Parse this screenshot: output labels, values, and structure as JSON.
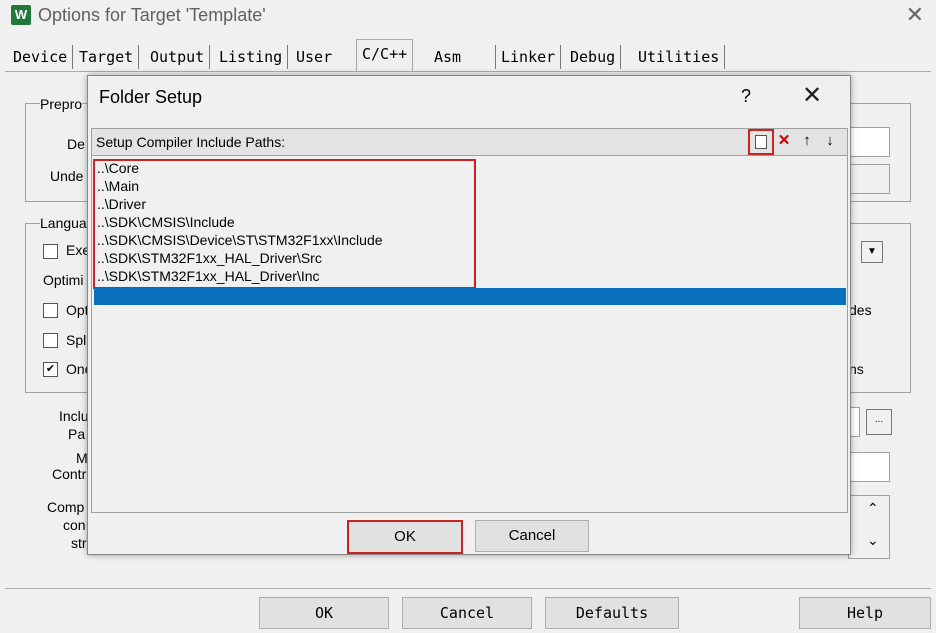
{
  "window": {
    "title": "Options for Target 'Template'",
    "logo_text": "W"
  },
  "tabs": [
    "Device",
    "Target",
    "Output",
    "Listing",
    "User",
    "C/C++",
    "Asm",
    "Linker",
    "Debug",
    "Utilities"
  ],
  "active_tab": "C/C++",
  "background_labels": {
    "prepro": "Prepro",
    "de": "De",
    "unde": "Unde",
    "langua": "Langua",
    "exe": "Exe",
    "optimi": "Optimi",
    "opt": "Opt",
    "spl": "Spl",
    "one": "One",
    "incl": "Inclu",
    "pa": "Pa",
    "m": "M",
    "contr": "Contr",
    "comp": "Comp",
    "con": "con",
    "str": "str",
    "des": "des",
    "ns": "ns",
    "browse": "..."
  },
  "bottom_buttons": {
    "ok": "OK",
    "cancel": "Cancel",
    "defaults": "Defaults",
    "help": "Help"
  },
  "dialog": {
    "title": "Folder Setup",
    "help": "?",
    "close": "✕",
    "list_label": "Setup Compiler Include Paths:",
    "paths": [
      "..\\Core",
      "..\\Main",
      "..\\Driver",
      "..\\SDK\\CMSIS\\Include",
      "..\\SDK\\CMSIS\\Device\\ST\\STM32F1xx\\Include",
      "..\\SDK\\STM32F1xx_HAL_Driver\\Src",
      "..\\SDK\\STM32F1xx_HAL_Driver\\Inc"
    ],
    "ok": "OK",
    "cancel": "Cancel"
  },
  "colors": {
    "selection": "#0a6fbd",
    "highlight": "#cc2222",
    "logo": "#1f7a3a"
  }
}
